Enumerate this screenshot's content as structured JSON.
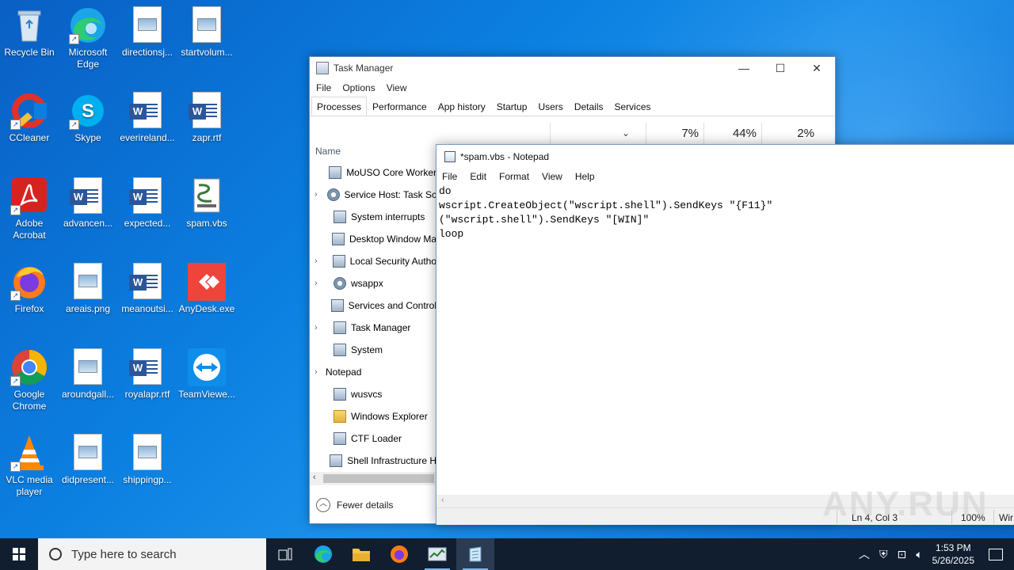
{
  "desktop": {
    "icons": [
      {
        "label": "Recycle Bin"
      },
      {
        "label": "Microsoft Edge"
      },
      {
        "label": "directionsj..."
      },
      {
        "label": "startvolum..."
      },
      {
        "label": "CCleaner"
      },
      {
        "label": "Skype"
      },
      {
        "label": "everireland..."
      },
      {
        "label": "zapr.rtf"
      },
      {
        "label": "Adobe Acrobat"
      },
      {
        "label": "advancen..."
      },
      {
        "label": "expected..."
      },
      {
        "label": "spam.vbs"
      },
      {
        "label": "Firefox"
      },
      {
        "label": "areais.png"
      },
      {
        "label": "meanoutsi..."
      },
      {
        "label": "AnyDesk.exe"
      },
      {
        "label": "Google Chrome"
      },
      {
        "label": "aroundgall..."
      },
      {
        "label": "royalapr.rtf"
      },
      {
        "label": "TeamViewe..."
      },
      {
        "label": "VLC media player"
      },
      {
        "label": "didpresent..."
      },
      {
        "label": "shippingp..."
      }
    ]
  },
  "task_manager": {
    "title": "Task Manager",
    "menu": [
      "File",
      "Options",
      "View"
    ],
    "tabs": [
      "Processes",
      "Performance",
      "App history",
      "Startup",
      "Users",
      "Details",
      "Services"
    ],
    "active_tab": "Processes",
    "usage": [
      "7%",
      "44%",
      "2%"
    ],
    "column_name": "Name",
    "processes": [
      {
        "name": "MoUSO Core Worker",
        "expandable": false
      },
      {
        "name": "Service Host: Task Sc",
        "expandable": true
      },
      {
        "name": "System interrupts",
        "expandable": false
      },
      {
        "name": "Desktop Window Ma",
        "expandable": false
      },
      {
        "name": "Local Security Autho",
        "expandable": true
      },
      {
        "name": "wsappx",
        "expandable": true
      },
      {
        "name": "Services and Control",
        "expandable": false
      },
      {
        "name": "Task Manager",
        "expandable": true
      },
      {
        "name": "System",
        "expandable": false
      },
      {
        "name": "Notepad",
        "expandable": true
      },
      {
        "name": "wusvcs",
        "expandable": false
      },
      {
        "name": "Windows Explorer",
        "expandable": false
      },
      {
        "name": "CTF Loader",
        "expandable": false
      },
      {
        "name": "Shell Infrastructure H",
        "expandable": false
      }
    ],
    "footer": "Fewer details"
  },
  "notepad": {
    "title": "*spam.vbs - Notepad",
    "menu": [
      "File",
      "Edit",
      "Format",
      "View",
      "Help"
    ],
    "content": "do\nwscript.CreateObject(\"wscript.shell\").SendKeys \"{F11}\"\n(\"wscript.shell\").SendKeys \"[WIN]\"\nloop",
    "status": {
      "position": "Ln 4, Col 3",
      "zoom": "100%",
      "encoding": "Wir"
    }
  },
  "watermark": "ANY.RUN",
  "taskbar": {
    "search_placeholder": "Type here to search",
    "time": "1:53 PM",
    "date": "5/26/2025"
  }
}
